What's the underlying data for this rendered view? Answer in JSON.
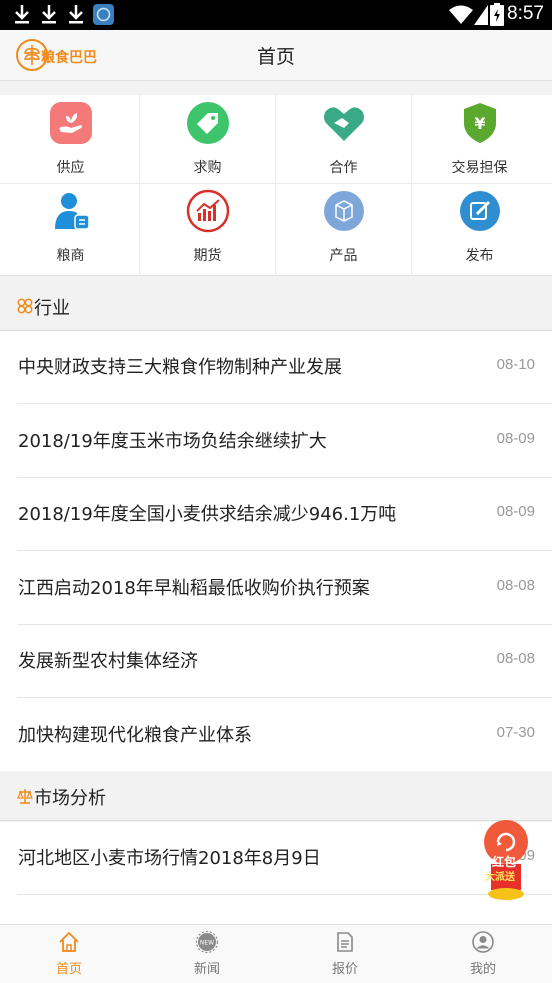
{
  "status_bar": {
    "time": "8:57"
  },
  "header": {
    "logo_text": "粮食巴巴",
    "title": "首页"
  },
  "grid": [
    {
      "label": "供应",
      "icon": "supply-icon",
      "color": "#f47a7a"
    },
    {
      "label": "求购",
      "icon": "purchase-tag-icon",
      "color": "#3ec46a"
    },
    {
      "label": "合作",
      "icon": "handshake-heart-icon",
      "color": "#3aa985"
    },
    {
      "label": "交易担保",
      "icon": "shield-yen-icon",
      "color": "#5aa82e"
    },
    {
      "label": "粮商",
      "icon": "merchant-person-icon",
      "color": "#1e8fd8"
    },
    {
      "label": "期货",
      "icon": "futures-chart-icon",
      "color": "#d9302a"
    },
    {
      "label": "产品",
      "icon": "product-box-icon",
      "color": "#7fa6d8"
    },
    {
      "label": "发布",
      "icon": "publish-edit-icon",
      "color": "#2f8ed0"
    }
  ],
  "sections": {
    "industry": {
      "title": "行业",
      "icon": "industry-icon"
    },
    "market": {
      "title": "市场分析",
      "icon": "scale-icon"
    }
  },
  "industry_news": [
    {
      "title": "中央财政支持三大粮食作物制种产业发展",
      "date": "08-10"
    },
    {
      "title": "2018/19年度玉米市场负结余继续扩大",
      "date": "08-09"
    },
    {
      "title": "2018/19年度全国小麦供求结余减少946.1万吨",
      "date": "08-09"
    },
    {
      "title": "江西启动2018年早籼稻最低收购价执行预案",
      "date": "08-08"
    },
    {
      "title": "发展新型农村集体经济",
      "date": "08-08"
    },
    {
      "title": "加快构建现代化粮食产业体系",
      "date": "07-30"
    }
  ],
  "market_news": [
    {
      "title": "河北地区小麦市场行情2018年8月9日",
      "date": "08-09"
    }
  ],
  "floating_badge": {
    "line1": "红包",
    "line2": "大派送"
  },
  "tabs": [
    {
      "label": "首页",
      "icon": "home-icon",
      "active": true
    },
    {
      "label": "新闻",
      "icon": "news-gear-icon",
      "active": false
    },
    {
      "label": "报价",
      "icon": "quote-document-icon",
      "active": false
    },
    {
      "label": "我的",
      "icon": "profile-icon",
      "active": false
    }
  ],
  "colors": {
    "accent": "#f08a1a"
  }
}
